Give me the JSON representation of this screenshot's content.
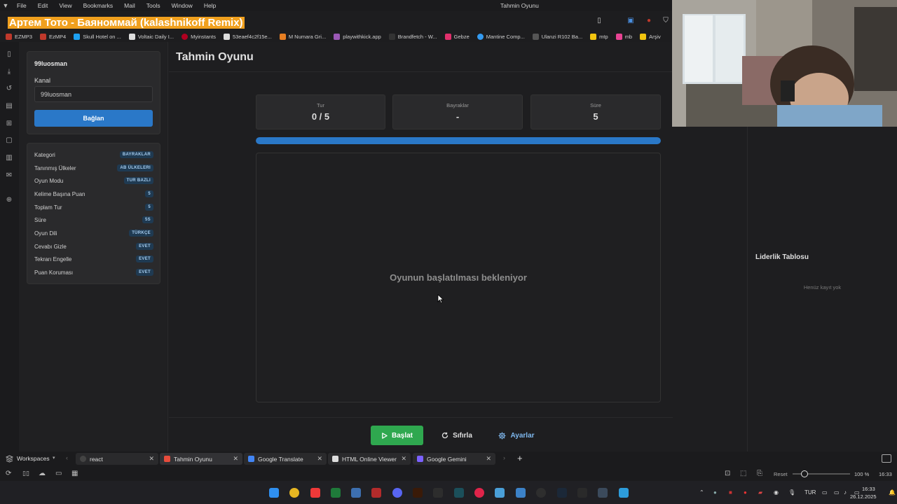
{
  "menubar": {
    "items": [
      "File",
      "Edit",
      "View",
      "Bookmarks",
      "Mail",
      "Tools",
      "Window",
      "Help"
    ],
    "window_title": "Tahmin Oyunu"
  },
  "music_overlay": "Артем Тото - Баяноммай (kalashnikoff Remix)",
  "bookmarks": [
    {
      "label": "EZMP3",
      "color": "#c0392b"
    },
    {
      "label": "EzMP4",
      "color": "#c0392b"
    },
    {
      "label": "Skull Hotel on ...",
      "color": "#1da1f2"
    },
    {
      "label": "Voltaic Daily I...",
      "color": "#dddddd"
    },
    {
      "label": "Myinstants",
      "color": "#b00020"
    },
    {
      "label": "53eaef4c2f15e...",
      "color": "#dddddd"
    },
    {
      "label": "M Numara Gri...",
      "color": "#e67e22"
    },
    {
      "label": "playwithkick.app",
      "color": "#9b59b6"
    },
    {
      "label": "Brandfetch - W...",
      "color": "#333333"
    },
    {
      "label": "Gebze",
      "color": "#e1306c"
    },
    {
      "label": "Mantine Comp...",
      "color": "#339af0"
    },
    {
      "label": "Ulanzi R102 Ba...",
      "color": "#555555"
    },
    {
      "label": "mtp",
      "color": "#f1c40f"
    },
    {
      "label": "mb",
      "color": "#e84393"
    },
    {
      "label": "Arşiv",
      "color": "#f1c40f"
    }
  ],
  "left": {
    "username": "99luosman",
    "channel_label": "Kanal",
    "channel_value": "99luosman",
    "connect_label": "Bağlan",
    "settings": [
      {
        "label": "Kategori",
        "value": "BAYRAKLAR"
      },
      {
        "label": "Tanınmış Ülkeler",
        "value": "AB ÜLKELERI"
      },
      {
        "label": "Oyun Modu",
        "value": "TUR BAZLI"
      },
      {
        "label": "Kelime Başına Puan",
        "value": "5"
      },
      {
        "label": "Toplam Tur",
        "value": "5"
      },
      {
        "label": "Süre",
        "value": "5S"
      },
      {
        "label": "Oyun Dili",
        "value": "TÜRKÇE"
      },
      {
        "label": "Cevabı Gizle",
        "value": "EVET"
      },
      {
        "label": "Tekrarı Engelle",
        "value": "EVET"
      },
      {
        "label": "Puan Koruması",
        "value": "EVET"
      }
    ]
  },
  "main": {
    "title": "Tahmin Oyunu",
    "stats": [
      {
        "label": "Tur",
        "value": "0 / 5"
      },
      {
        "label": "Bayraklar",
        "value": "-"
      },
      {
        "label": "Süre",
        "value": "5"
      }
    ],
    "progress": 1.0,
    "waiting_text": "Oyunun başlatılması bekleniyor",
    "start_label": "Başlat",
    "reset_label": "Sıfırla",
    "settings_label": "Ayarlar"
  },
  "leaderboard": {
    "title": "Liderlik Tablosu",
    "empty_text": "Henüz kayıt yok"
  },
  "tabbar": {
    "workspaces_label": "Workspaces",
    "tabs": [
      {
        "label": "react",
        "icon": "#444444"
      },
      {
        "label": "Tahmin Oyunu",
        "icon": "#e74c3c"
      },
      {
        "label": "Google Translate",
        "icon": "#4285f4"
      },
      {
        "label": "HTML Online Viewer",
        "icon": "#dddddd"
      },
      {
        "label": "Google Gemini",
        "icon": "#7b61ff"
      }
    ]
  },
  "statusbar": {
    "reset_label": "Reset",
    "zoom": "100 %",
    "time": "16:33"
  },
  "taskbar": {
    "language": "TUR",
    "clock_time": "16:33",
    "clock_date": "26.12.2025"
  }
}
